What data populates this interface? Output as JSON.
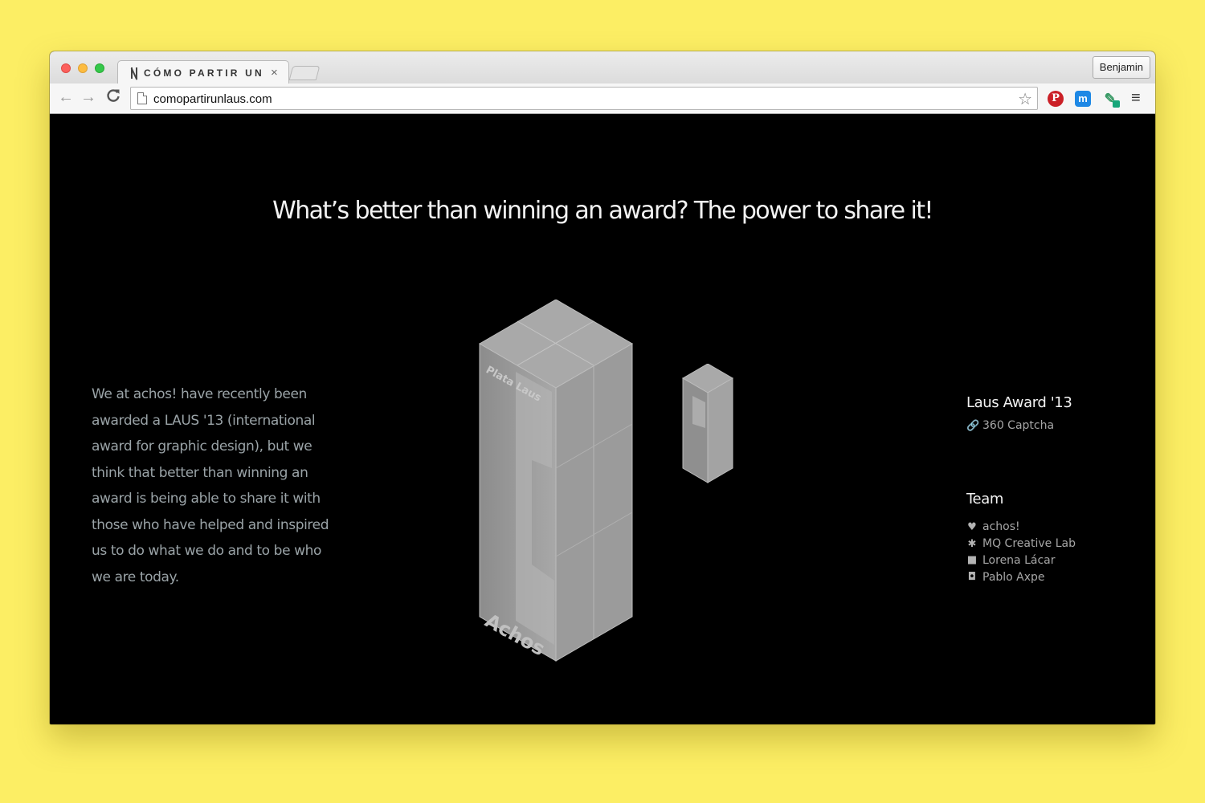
{
  "browser": {
    "tab_title": "CÓMO PARTIR UN LAUS",
    "tab_close": "×",
    "profile_name": "Benjamin",
    "url": "comopartirunlaus.com",
    "icons": {
      "back": "←",
      "forward": "→",
      "reload": "C",
      "star": "☆",
      "menu": "≡",
      "pinterest": "P",
      "messenger": "m",
      "eyedropper": "✎"
    }
  },
  "page": {
    "headline": "What’s better than winning an award? The power to share it!",
    "intro": "We at achos! have recently been awarded a LAUS '13 (international award for graphic design), but we think that better than winning an award is being able to share it with those who have helped and inspired us to do what we do and to be who we are today.",
    "trophy": {
      "face_label": "Plata Laus",
      "base_label": "Achos"
    },
    "award": {
      "title": "Laus Award '13",
      "link_icon": "🔗",
      "link_label": "360 Captcha"
    },
    "team": {
      "title": "Team",
      "members": [
        {
          "icon": "♥",
          "icon_name": "heart-icon",
          "name": "achos!"
        },
        {
          "icon": "✱",
          "icon_name": "gear-icon",
          "name": "MQ Creative Lab"
        },
        {
          "icon": "■",
          "icon_name": "video-camera-icon",
          "name": "Lorena Lácar"
        },
        {
          "icon": "◘",
          "icon_name": "camera-icon",
          "name": "Pablo Axpe"
        }
      ]
    }
  },
  "colors": {
    "background": "#fcee64",
    "page_bg": "#000000",
    "headline": "#f2f2f2",
    "body_text": "#9aa3a7",
    "trophy": "#9e9e9e"
  }
}
